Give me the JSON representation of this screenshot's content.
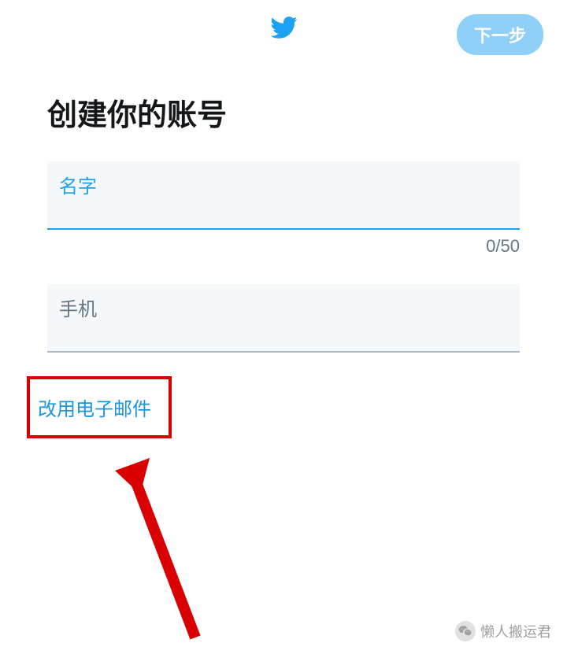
{
  "header": {
    "next_button": "下一步"
  },
  "title": "创建你的账号",
  "form": {
    "name_label": "名字",
    "name_counter": "0/50",
    "phone_label": "手机",
    "switch_to_email": "改用电子邮件"
  },
  "watermark": {
    "text": "懒人搬运君"
  }
}
